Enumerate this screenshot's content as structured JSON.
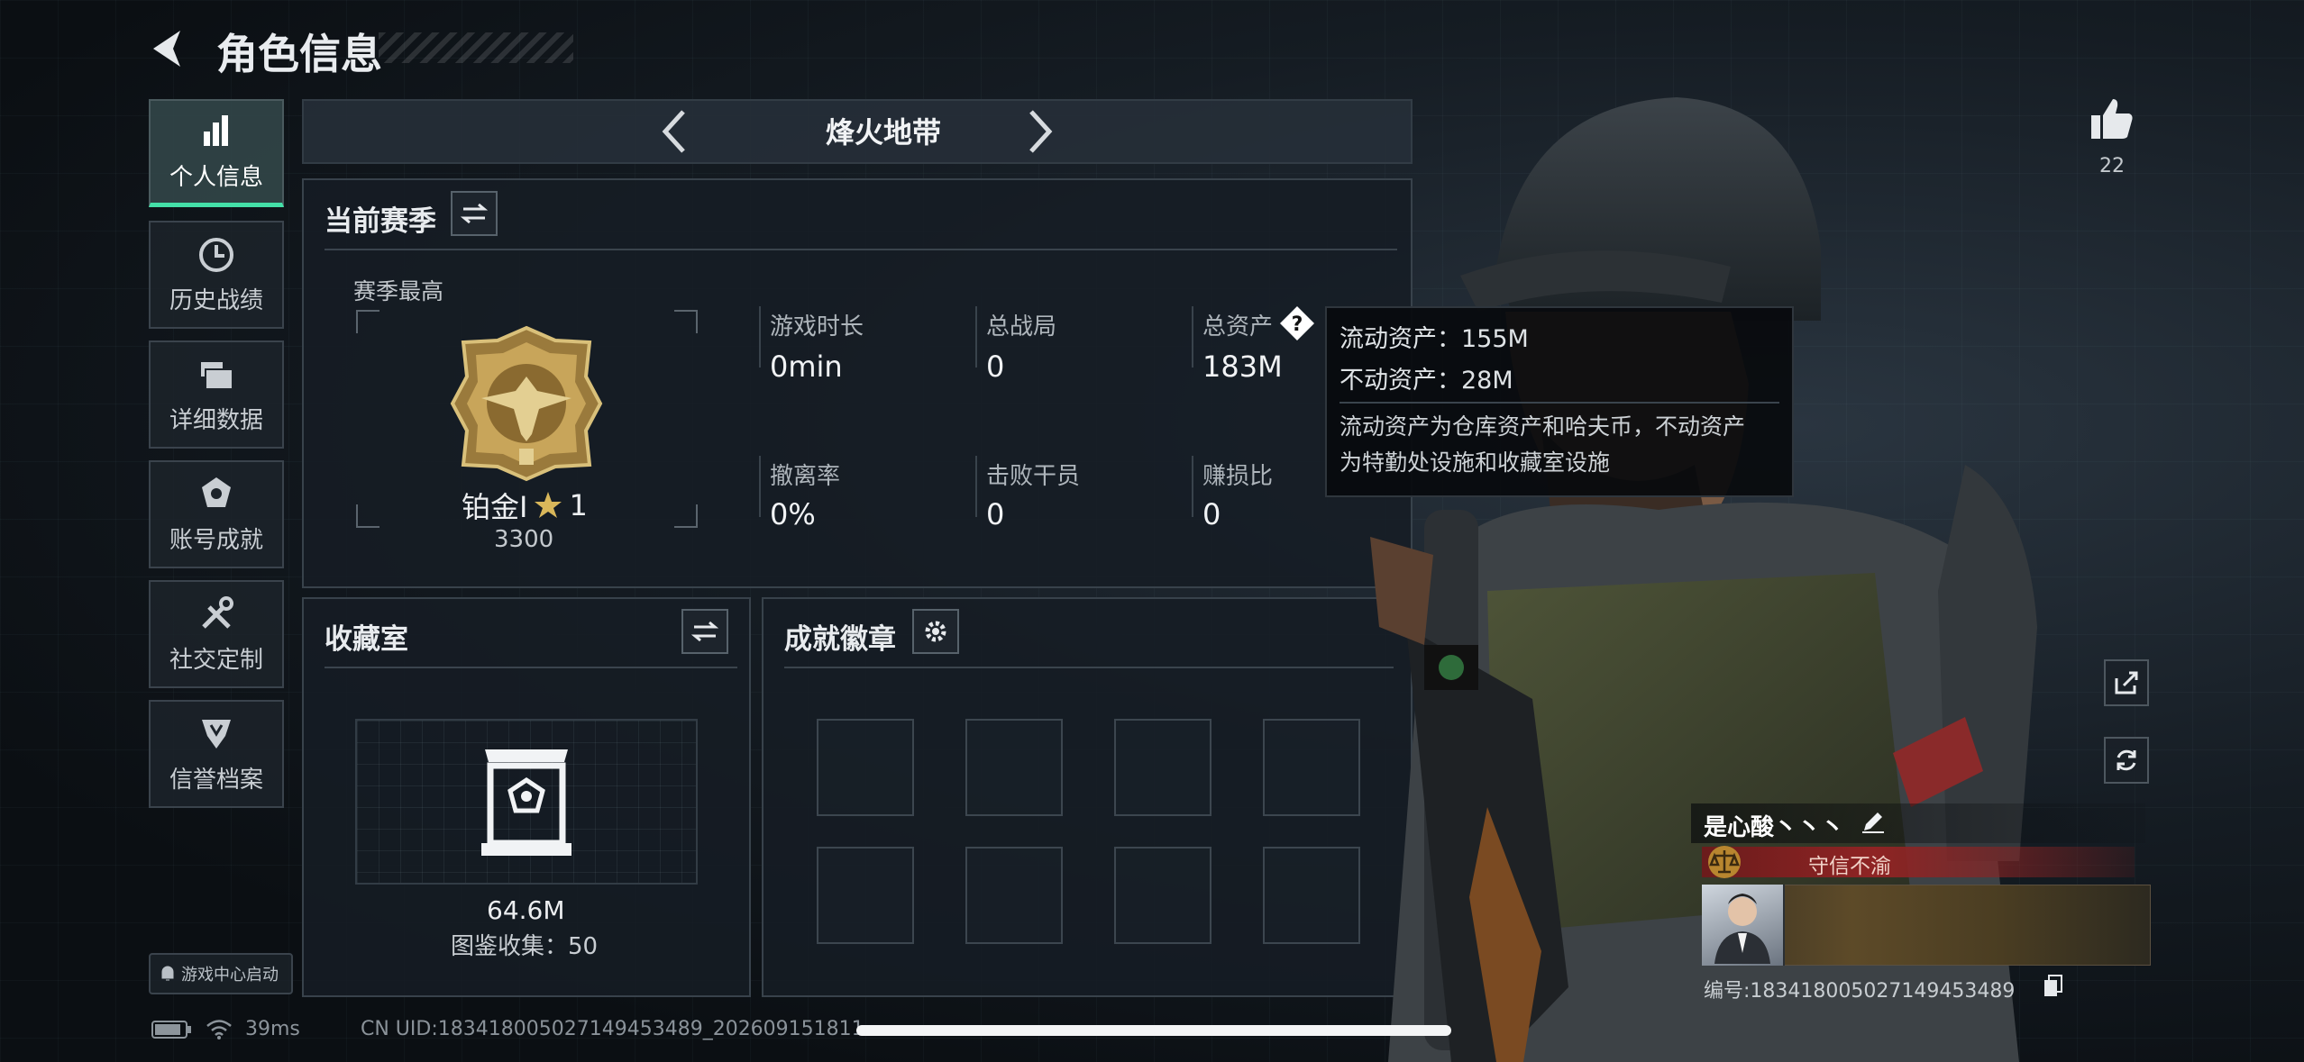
{
  "header": {
    "title": "角色信息"
  },
  "sidebar": {
    "items": [
      {
        "label": "个人信息",
        "icon": "bar-chart-icon",
        "active": true
      },
      {
        "label": "历史战绩",
        "icon": "clock-icon",
        "active": false
      },
      {
        "label": "详细数据",
        "icon": "folder-icon",
        "active": false
      },
      {
        "label": "账号成就",
        "icon": "medal-icon",
        "active": false
      },
      {
        "label": "社交定制",
        "icon": "tools-icon",
        "active": false
      },
      {
        "label": "信誉档案",
        "icon": "shield-badge-icon",
        "active": false
      }
    ],
    "game_center_label": "游戏中心启动"
  },
  "mode_bar": {
    "title": "烽火地带"
  },
  "season": {
    "title": "当前赛季",
    "best_label": "赛季最高",
    "rank_name": "铂金I",
    "rank_stars": "1",
    "rank_points": "3300",
    "stats": [
      {
        "label": "游戏时长",
        "value": "0min"
      },
      {
        "label": "总战局",
        "value": "0"
      },
      {
        "label": "总资产",
        "value": "183M"
      },
      {
        "label": "撤离率",
        "value": "0%"
      },
      {
        "label": "击败干员",
        "value": "0"
      },
      {
        "label": "赚损比",
        "value": "0"
      }
    ]
  },
  "tooltip": {
    "liquid": "流动资产：155M",
    "fixed": "不动资产：28M",
    "desc_line1": "流动资产为仓库资产和哈夫币，不动资产",
    "desc_line2": "为特勤处设施和收藏室设施"
  },
  "collection": {
    "title": "收藏室",
    "value": "64.6M",
    "catalog": "图鉴收集：50"
  },
  "achievements": {
    "title": "成就徽章"
  },
  "profile": {
    "likes": "22",
    "player_name": "是心酸丶丶丶",
    "honor_title": "守信不渝",
    "player_id": "编号:1834180050271494534​89"
  },
  "status": {
    "latency": "39ms",
    "uid": "CN UID:1834180050271494534​89_20260915​1811"
  },
  "colors": {
    "accent": "#44e0a8",
    "title_red": "#8f2424"
  }
}
